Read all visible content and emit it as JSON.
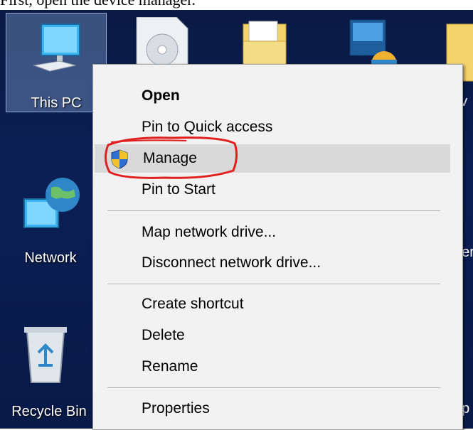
{
  "caption": "First, open the device manager.",
  "desktop": {
    "icons": [
      {
        "label": "This PC"
      },
      {
        "label": "Network"
      },
      {
        "label": "Recycle Bin"
      },
      {
        "label": "bv"
      },
      {
        "label": "per"
      },
      {
        "label": "up"
      }
    ]
  },
  "context_menu": {
    "items": [
      {
        "label": "Open"
      },
      {
        "label": "Pin to Quick access"
      },
      {
        "label": "Manage"
      },
      {
        "label": "Pin to Start"
      },
      {
        "label": "Map network drive..."
      },
      {
        "label": "Disconnect network drive..."
      },
      {
        "label": "Create shortcut"
      },
      {
        "label": "Delete"
      },
      {
        "label": "Rename"
      },
      {
        "label": "Properties"
      }
    ]
  },
  "colors": {
    "desktop": "#0b1f55",
    "menu_bg": "#f2f2f2",
    "highlight": "#d9d9d9",
    "annotation": "#e02020"
  }
}
